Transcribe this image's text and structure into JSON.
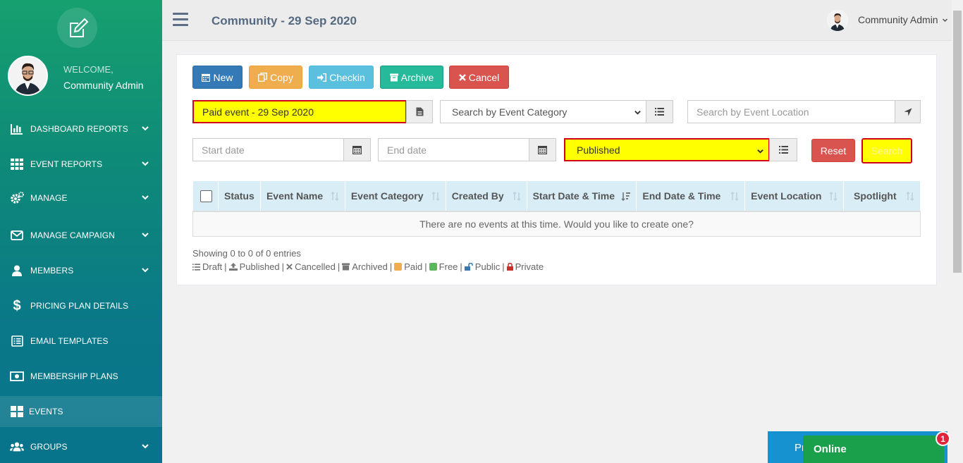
{
  "sidebar": {
    "welcome": "WELCOME,",
    "user_name": "Community Admin",
    "items": [
      {
        "label": "DASHBOARD REPORTS",
        "icon": "bar-chart-icon"
      },
      {
        "label": "EVENT REPORTS",
        "icon": "grid-icon"
      },
      {
        "label": "MANAGE",
        "icon": "gears-icon"
      },
      {
        "label": "MANAGE CAMPAIGN",
        "icon": "envelope-icon"
      },
      {
        "label": "MEMBERS",
        "icon": "user-icon"
      },
      {
        "label": "PRICING PLAN DETAILS",
        "icon": "dollar-icon"
      },
      {
        "label": "EMAIL TEMPLATES",
        "icon": "list-alt-icon"
      },
      {
        "label": "MEMBERSHIP PLANS",
        "icon": "money-icon"
      },
      {
        "label": "EVENTS",
        "icon": "th-large-icon"
      },
      {
        "label": "GROUPS",
        "icon": "users-icon"
      }
    ]
  },
  "header": {
    "title": "Community - 29 Sep 2020",
    "user": "Community Admin"
  },
  "toolbar": {
    "new": "New",
    "copy": "Copy",
    "checkin": "Checkin",
    "archive": "Archive",
    "cancel": "Cancel"
  },
  "filters": {
    "event_name_value": "Paid event - 29 Sep 2020",
    "category_placeholder": "Search by Event Category",
    "location_placeholder": "Search by Event Location",
    "start_date_placeholder": "Start date",
    "end_date_placeholder": "End date",
    "status_value": "Published",
    "reset": "Reset",
    "search": "Search"
  },
  "table": {
    "columns": [
      "Status",
      "Event Name",
      "Event Category",
      "Created By",
      "Start Date & Time",
      "End Date & Time",
      "Event Location",
      "Spotlight"
    ],
    "empty_message": "There are no events at this time. Would you like to create one?",
    "showing": "Showing 0 to 0 of 0 entries"
  },
  "legend": {
    "draft": "Draft",
    "published": "Published",
    "cancelled": "Cancelled",
    "archived": "Archived",
    "paid": "Paid",
    "free": "Free",
    "public": "Public",
    "private": "Private",
    "sep": "|"
  },
  "chat": {
    "promo": "Pr",
    "online": "Online",
    "badge": "1"
  },
  "colors": {
    "new": "#337ab7",
    "copy": "#f0ad4e",
    "checkin": "#5bc0de",
    "archive": "#26b99a",
    "cancel": "#d9534f",
    "highlight": "#ffff00",
    "online": "#1aa04a"
  }
}
